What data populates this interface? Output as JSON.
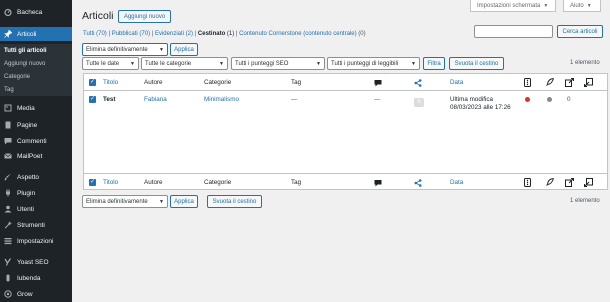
{
  "sidebar": {
    "items": [
      {
        "label": "Bacheca",
        "icon": "dashboard-icon"
      },
      {
        "label": "Articoli",
        "icon": "pin-icon",
        "active": true
      },
      {
        "label": "Media",
        "icon": "media-icon"
      },
      {
        "label": "Pagine",
        "icon": "page-icon"
      },
      {
        "label": "Commenti",
        "icon": "comment-icon"
      },
      {
        "label": "MailPoet",
        "icon": "mailpoet-icon"
      },
      {
        "label": "Aspetto",
        "icon": "brush-icon"
      },
      {
        "label": "Plugin",
        "icon": "plug-icon"
      },
      {
        "label": "Utenti",
        "icon": "user-icon"
      },
      {
        "label": "Strumenti",
        "icon": "wrench-icon"
      },
      {
        "label": "Impostazioni",
        "icon": "settings-icon"
      },
      {
        "label": "Yoast SEO",
        "icon": "yoast-icon"
      },
      {
        "label": "Iubenda",
        "icon": "iubenda-icon"
      },
      {
        "label": "Grow",
        "icon": "grow-icon"
      }
    ],
    "submenu": [
      "Tutti gli articoli",
      "Aggiungi nuovo",
      "Categorie",
      "Tag"
    ]
  },
  "screen_options": "Impostazioni schermata",
  "help": "Aiuto",
  "page_title": "Articoli",
  "add_new": "Aggiungi nuovo",
  "views": {
    "all": "Tutti",
    "all_count": "(70)",
    "published": "Pubblicati",
    "published_count": "(70)",
    "sticky": "Evidenziati",
    "sticky_count": "(2)",
    "trash": "Cestinato",
    "trash_count": "(1)",
    "cornerstone": "Contenuto Cornerstone (contenuto centrale)",
    "cornerstone_count": "(0)"
  },
  "search_input": "",
  "search_button": "Cerca articoli",
  "bulk_action": "Elimina definitivamente",
  "apply": "Applica",
  "filters": {
    "dates": "Tutte le date",
    "categories": "Tutte le categorie",
    "seo": "Tutti i punteggi SEO",
    "readability": "Tutti i punteggi di leggibili",
    "filter_button": "Filtra",
    "empty_trash": "Svuota il cestino"
  },
  "items_count": "1 elemento",
  "columns": {
    "title": "Titolo",
    "author": "Autore",
    "categories": "Categorie",
    "tags": "Tag",
    "date": "Data"
  },
  "row": {
    "title": "Test",
    "author": "Fabiana",
    "category": "Minimalismo",
    "tags": "—",
    "comments_dash": "—",
    "comments_count": "0",
    "date_label": "Ultima modifica",
    "date_value": "08/03/2023 alle 17:26",
    "links_count": "0",
    "seo_color": "#dc3232",
    "readability_color": "#888888"
  }
}
